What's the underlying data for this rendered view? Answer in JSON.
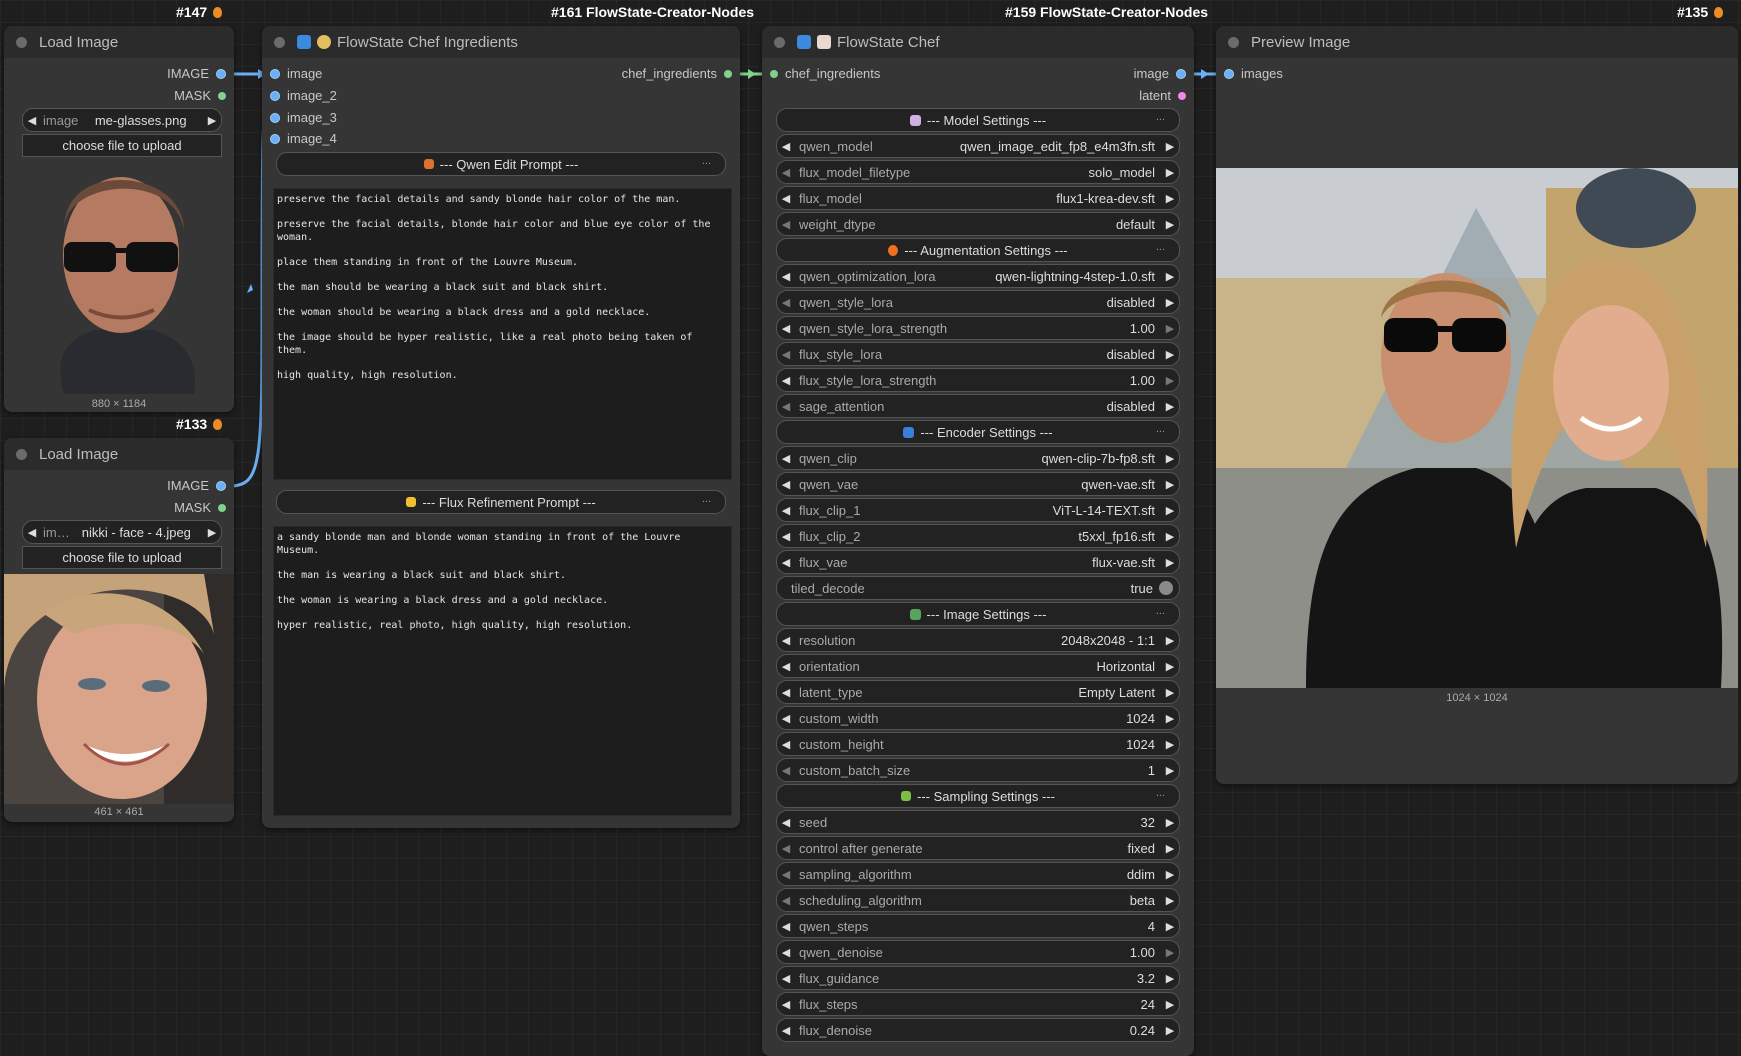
{
  "badges": {
    "b147": "#147",
    "b161": "#161 FlowState-Creator-Nodes",
    "b159": "#159 FlowState-Creator-Nodes",
    "b135": "#135",
    "b133": "#133"
  },
  "load_image_1": {
    "title": "Load Image",
    "out_image": "IMAGE",
    "out_mask": "MASK",
    "combo_label": "image",
    "combo_value": "me-glasses.png",
    "upload_label": "choose file to upload",
    "size": "880 × 1184"
  },
  "load_image_2": {
    "title": "Load Image",
    "out_image": "IMAGE",
    "out_mask": "MASK",
    "combo_label": "im…",
    "combo_value": "nikki - face - 4.jpeg",
    "upload_label": "choose file to upload",
    "size": "461 × 461"
  },
  "ingredients": {
    "title": "FlowState Chef Ingredients",
    "inputs": [
      "image",
      "image_2",
      "image_3",
      "image_4"
    ],
    "output": "chef_ingredients",
    "qwen_section": "--- Qwen Edit Prompt ---",
    "qwen_lines": [
      "preserve the facial details and sandy blonde hair color of the man.",
      "preserve the facial details, blonde hair color and blue eye color of the woman.",
      "place them standing in front of the Louvre Museum.",
      "the man should be wearing a black suit and black shirt.",
      "the woman should be wearing a black dress and a gold necklace.",
      "the image should be hyper realistic, like a real photo being taken of them.",
      "high quality, high resolution."
    ],
    "flux_section": "--- Flux Refinement Prompt ---",
    "flux_lines": [
      "a sandy blonde man and blonde woman standing in front of the Louvre Museum.",
      "the man is wearing a black suit and black shirt.",
      "the woman is wearing a black dress and a gold necklace.",
      "hyper realistic, real photo, high quality, high resolution."
    ],
    "menu_dots": "..."
  },
  "chef": {
    "title": "FlowState Chef",
    "input": "chef_ingredients",
    "out_image": "image",
    "out_latent": "latent",
    "sections": {
      "model": "--- Model Settings ---",
      "aug": "--- Augmentation Settings ---",
      "enc": "--- Encoder Settings ---",
      "img": "--- Image Settings ---",
      "samp": "--- Sampling Settings ---"
    },
    "widgets": [
      {
        "label": "qwen_model",
        "value": "qwen_image_edit_fp8_e4m3fn.sft"
      },
      {
        "label": "flux_model_filetype",
        "value": "solo_model"
      },
      {
        "label": "flux_model",
        "value": "flux1-krea-dev.sft"
      },
      {
        "label": "weight_dtype",
        "value": "default"
      },
      {
        "label": "qwen_optimization_lora",
        "value": "qwen-lightning-4step-1.0.sft"
      },
      {
        "label": "qwen_style_lora",
        "value": "disabled"
      },
      {
        "label": "qwen_style_lora_strength",
        "value": "1.00"
      },
      {
        "label": "flux_style_lora",
        "value": "disabled"
      },
      {
        "label": "flux_style_lora_strength",
        "value": "1.00"
      },
      {
        "label": "sage_attention",
        "value": "disabled"
      },
      {
        "label": "qwen_clip",
        "value": "qwen-clip-7b-fp8.sft"
      },
      {
        "label": "qwen_vae",
        "value": "qwen-vae.sft"
      },
      {
        "label": "flux_clip_1",
        "value": "ViT-L-14-TEXT.sft"
      },
      {
        "label": "flux_clip_2",
        "value": "t5xxl_fp16.sft"
      },
      {
        "label": "flux_vae",
        "value": "flux-vae.sft"
      },
      {
        "label": "tiled_decode",
        "value": "true"
      },
      {
        "label": "resolution",
        "value": "2048x2048 - 1:1"
      },
      {
        "label": "orientation",
        "value": "Horizontal"
      },
      {
        "label": "latent_type",
        "value": "Empty Latent"
      },
      {
        "label": "custom_width",
        "value": "1024"
      },
      {
        "label": "custom_height",
        "value": "1024"
      },
      {
        "label": "custom_batch_size",
        "value": "1"
      },
      {
        "label": "seed",
        "value": "32"
      },
      {
        "label": "control after generate",
        "value": "fixed"
      },
      {
        "label": "sampling_algorithm",
        "value": "ddim"
      },
      {
        "label": "scheduling_algorithm",
        "value": "beta"
      },
      {
        "label": "qwen_steps",
        "value": "4"
      },
      {
        "label": "qwen_denoise",
        "value": "1.00"
      },
      {
        "label": "flux_guidance",
        "value": "3.2"
      },
      {
        "label": "flux_steps",
        "value": "24"
      },
      {
        "label": "flux_denoise",
        "value": "0.24"
      }
    ]
  },
  "preview": {
    "title": "Preview Image",
    "input": "images",
    "size": "1024 × 1024"
  },
  "colors": {
    "accent_link": "#6ab0f3",
    "node_bg": "#353535",
    "title_bg": "#2b2b2b"
  }
}
